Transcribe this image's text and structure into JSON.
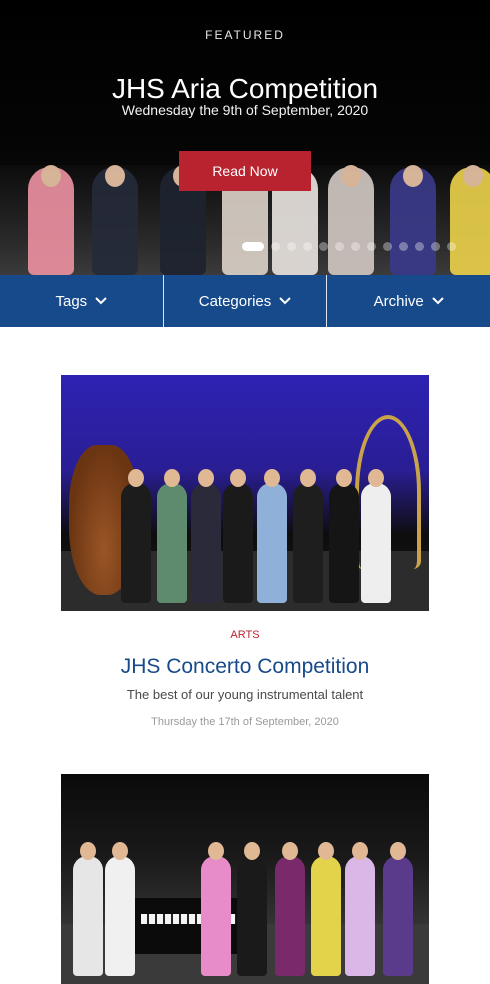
{
  "hero": {
    "kicker": "FEATURED",
    "title": "JHS Aria Competition",
    "date": "Wednesday the 9th of September, 2020",
    "button_label": "Read Now",
    "slides_total": 14,
    "active_slide": 1
  },
  "nav": {
    "items": [
      {
        "label": "Tags"
      },
      {
        "label": "Categories"
      },
      {
        "label": "Archive"
      }
    ]
  },
  "articles": [
    {
      "category": "ARTS",
      "title": "JHS Concerto Competition",
      "subtitle": "The best of our young instrumental talent",
      "date": "Thursday the 17th of September, 2020"
    }
  ],
  "colors": {
    "brand_blue": "#174a8b",
    "accent_red": "#b8232f"
  }
}
